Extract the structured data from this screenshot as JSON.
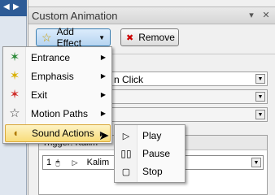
{
  "window": {
    "title": "Custom Animation"
  },
  "toolbar": {
    "add_effect_label": "Add Effect",
    "remove_label": "Remove"
  },
  "fields": {
    "start_value": "n Click"
  },
  "menu": {
    "items": [
      {
        "label": "Entrance",
        "icon": "entrance-star-icon",
        "has_submenu": true
      },
      {
        "label": "Emphasis",
        "icon": "emphasis-star-icon",
        "has_submenu": true
      },
      {
        "label": "Exit",
        "icon": "exit-star-icon",
        "has_submenu": true
      },
      {
        "label": "Motion Paths",
        "icon": "motion-path-star-icon",
        "has_submenu": true
      },
      {
        "label": "Sound Actions",
        "icon": "sound-speaker-icon",
        "has_submenu": true,
        "highlighted": true
      }
    ]
  },
  "submenu": {
    "items": [
      {
        "label": "Play",
        "icon": "play-icon"
      },
      {
        "label": "Pause",
        "icon": "pause-icon"
      },
      {
        "label": "Stop",
        "icon": "stop-icon"
      }
    ]
  },
  "animation_list": {
    "trigger": "Trigger: Kalim",
    "row_index": "1",
    "row_label": "Kalim"
  },
  "colors": {
    "highlight": "#f8dc7a",
    "selected_strip": "#2d5b96"
  }
}
